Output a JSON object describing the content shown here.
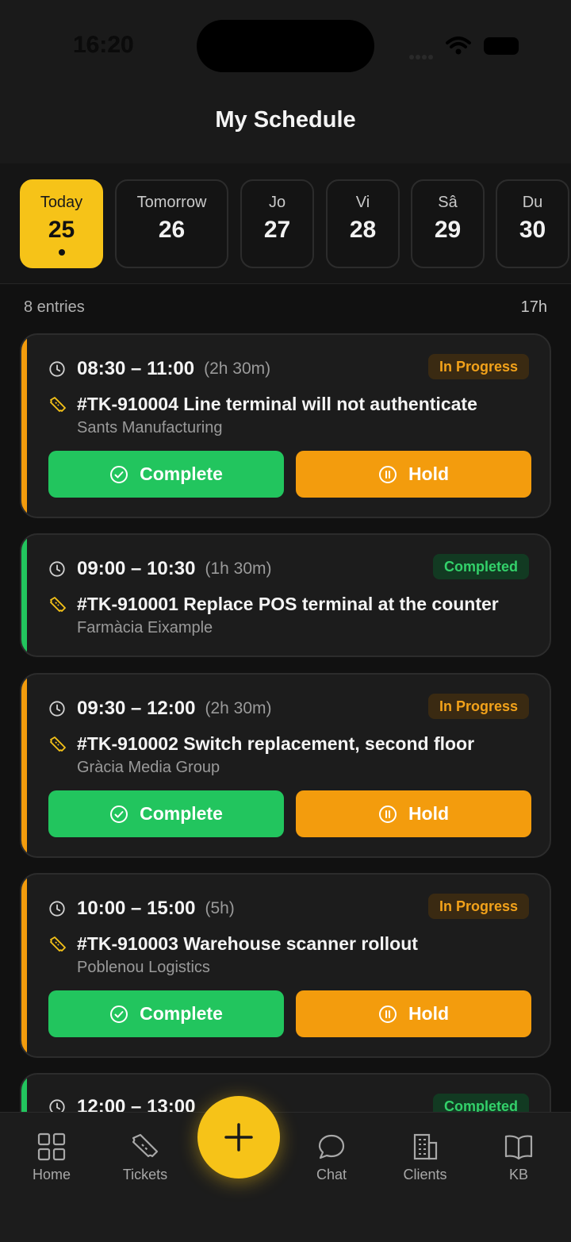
{
  "status": {
    "time": "16:20"
  },
  "header": {
    "title": "My Schedule"
  },
  "days": [
    {
      "name": "Today",
      "num": "25",
      "active": true
    },
    {
      "name": "Tomorrow",
      "num": "26"
    },
    {
      "name": "Jo",
      "num": "27"
    },
    {
      "name": "Vi",
      "num": "28"
    },
    {
      "name": "Sâ",
      "num": "29"
    },
    {
      "name": "Du",
      "num": "30"
    }
  ],
  "summary": {
    "entries": "8 entries",
    "total": "17h"
  },
  "entries": [
    {
      "time": "08:30 – 11:00",
      "duration": "(2h 30m)",
      "status": "In Progress",
      "title": "#TK-910004 Line terminal will not authenticate",
      "client": "Sants Manufacturing",
      "complete_label": "Complete",
      "hold_label": "Hold"
    },
    {
      "time": "09:00 – 10:30",
      "duration": "(1h 30m)",
      "status": "Completed",
      "title": "#TK-910001 Replace POS terminal at the counter",
      "client": "Farmàcia Eixample"
    },
    {
      "time": "09:30 – 12:00",
      "duration": "(2h 30m)",
      "status": "In Progress",
      "title": "#TK-910002 Switch replacement, second floor",
      "client": "Gràcia Media Group",
      "complete_label": "Complete",
      "hold_label": "Hold"
    },
    {
      "time": "10:00 – 15:00",
      "duration": "(5h)",
      "status": "In Progress",
      "title": "#TK-910003 Warehouse scanner rollout",
      "client": "Poblenou Logistics",
      "complete_label": "Complete",
      "hold_label": "Hold"
    },
    {
      "time": "12:00 – 13:00",
      "status": "Completed"
    }
  ],
  "colors": {
    "accent": "#f6c318",
    "in_progress": "#f39c0d",
    "completed": "#22c55e"
  },
  "tabs": [
    {
      "label": "Home",
      "icon": "grid-icon"
    },
    {
      "label": "Tickets",
      "icon": "ticket-icon"
    },
    {
      "label": "Chat",
      "icon": "chat-bubble-icon"
    },
    {
      "label": "Clients",
      "icon": "building-icon"
    },
    {
      "label": "KB",
      "icon": "book-icon"
    }
  ],
  "fab": {
    "icon": "plus-icon"
  }
}
